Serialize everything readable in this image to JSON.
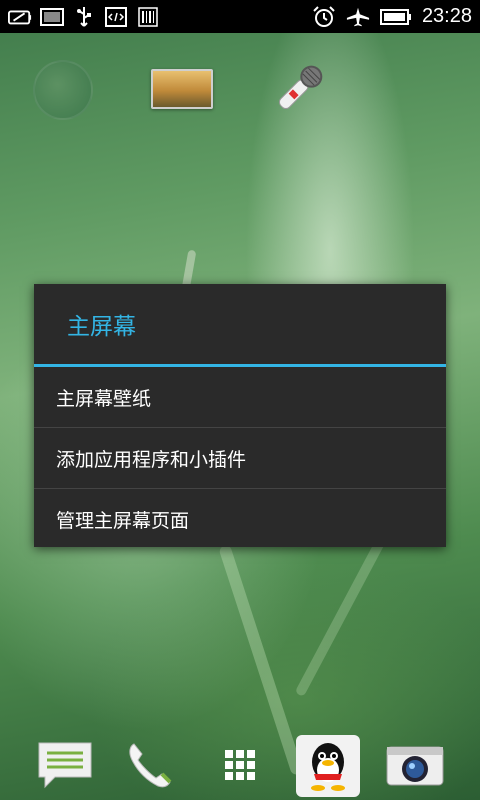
{
  "status_bar": {
    "time": "23:28",
    "left_icons": [
      "battery-saver-icon",
      "screen-icon",
      "usb-icon",
      "code-icon",
      "barcode-icon"
    ],
    "right_icons": [
      "alarm-icon",
      "airplane-icon",
      "battery-icon"
    ]
  },
  "desktop_icons": [
    "globe-icon",
    "gallery-icon",
    "microphone-icon"
  ],
  "dialog": {
    "title": "主屏幕",
    "items": [
      {
        "label": "主屏幕壁纸"
      },
      {
        "label": "添加应用程序和小插件"
      },
      {
        "label": "管理主屏幕页面"
      }
    ]
  },
  "dock": {
    "items": [
      "messages-icon",
      "phone-icon",
      "app-drawer-icon",
      "qq-icon",
      "camera-icon"
    ]
  },
  "colors": {
    "accent": "#33b5e5",
    "dialog_bg": "#2a2a2a",
    "status_bar_bg": "#000000"
  }
}
